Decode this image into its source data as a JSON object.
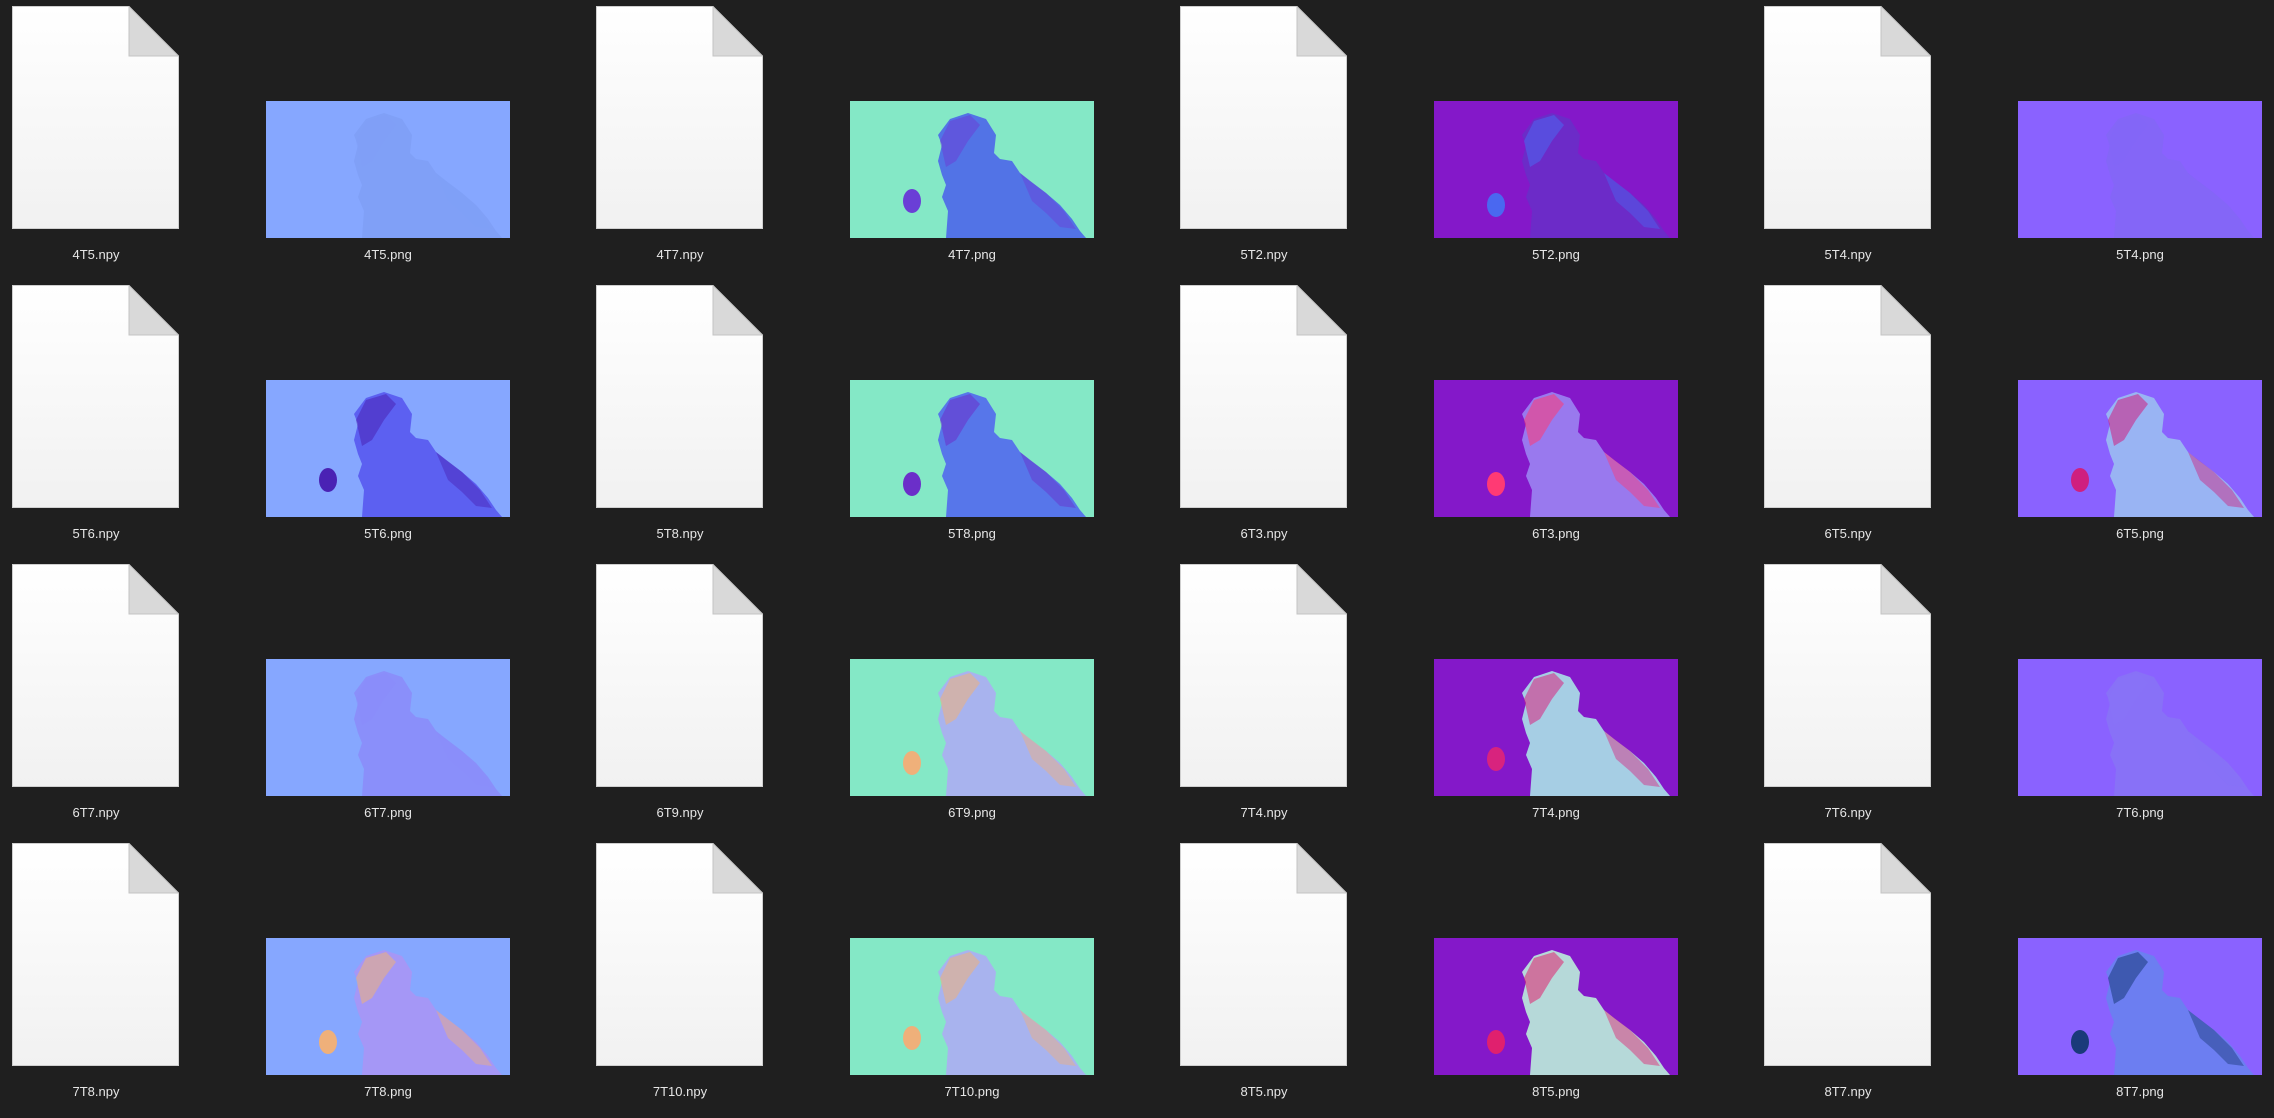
{
  "files": [
    {
      "name": "4T5.npy",
      "kind": "npy"
    },
    {
      "name": "4T5.png",
      "kind": "png",
      "bg": "#86a7ff",
      "fg": "#7f9ff7",
      "accent": ""
    },
    {
      "name": "4T7.npy",
      "kind": "npy"
    },
    {
      "name": "4T7.png",
      "kind": "png",
      "bg": "#84e8c6",
      "fg": "#4f6de8",
      "accent": "#6a3fd6"
    },
    {
      "name": "5T2.npy",
      "kind": "npy"
    },
    {
      "name": "5T2.png",
      "kind": "png",
      "bg": "#8418c9",
      "fg": "#6a2cc8",
      "accent": "#4a68f0"
    },
    {
      "name": "5T4.npy",
      "kind": "npy"
    },
    {
      "name": "5T4.png",
      "kind": "png",
      "bg": "#8a62ff",
      "fg": "#8466f7",
      "accent": ""
    },
    {
      "name": "5T6.npy",
      "kind": "npy"
    },
    {
      "name": "5T6.png",
      "kind": "png",
      "bg": "#86a7ff",
      "fg": "#5a5cf0",
      "accent": "#4a22b4"
    },
    {
      "name": "5T8.npy",
      "kind": "npy"
    },
    {
      "name": "5T8.png",
      "kind": "png",
      "bg": "#84e8c6",
      "fg": "#5470ec",
      "accent": "#6b2fc9"
    },
    {
      "name": "6T3.npy",
      "kind": "npy"
    },
    {
      "name": "6T3.png",
      "kind": "png",
      "bg": "#8418c9",
      "fg": "#9a7ef0",
      "accent": "#ff3a74"
    },
    {
      "name": "6T5.npy",
      "kind": "npy"
    },
    {
      "name": "6T5.png",
      "kind": "png",
      "bg": "#8a62ff",
      "fg": "#9ab8f2",
      "accent": "#cf1f7f"
    },
    {
      "name": "6T7.npy",
      "kind": "npy"
    },
    {
      "name": "6T7.png",
      "kind": "png",
      "bg": "#86a7ff",
      "fg": "#8a8dfa",
      "accent": ""
    },
    {
      "name": "6T9.npy",
      "kind": "npy"
    },
    {
      "name": "6T9.png",
      "kind": "png",
      "bg": "#84e8c6",
      "fg": "#aab0f0",
      "accent": "#efb07a"
    },
    {
      "name": "7T4.npy",
      "kind": "npy"
    },
    {
      "name": "7T4.png",
      "kind": "png",
      "bg": "#8418c9",
      "fg": "#a8d8e6",
      "accent": "#d8237e"
    },
    {
      "name": "7T6.npy",
      "kind": "npy"
    },
    {
      "name": "7T6.png",
      "kind": "png",
      "bg": "#8a62ff",
      "fg": "#8872f7",
      "accent": ""
    },
    {
      "name": "7T8.npy",
      "kind": "npy"
    },
    {
      "name": "7T8.png",
      "kind": "png",
      "bg": "#86a7ff",
      "fg": "#a796f5",
      "accent": "#efb07a"
    },
    {
      "name": "7T10.npy",
      "kind": "npy"
    },
    {
      "name": "7T10.png",
      "kind": "png",
      "bg": "#84e8c6",
      "fg": "#aab0f0",
      "accent": "#efb07a"
    },
    {
      "name": "8T5.npy",
      "kind": "npy"
    },
    {
      "name": "8T5.png",
      "kind": "png",
      "bg": "#8418c9",
      "fg": "#b8e4da",
      "accent": "#e0206e"
    },
    {
      "name": "8T7.npy",
      "kind": "npy"
    },
    {
      "name": "8T7.png",
      "kind": "png",
      "bg": "#8a62ff",
      "fg": "#6a7ff0",
      "accent": "#1a3a7a"
    }
  ]
}
